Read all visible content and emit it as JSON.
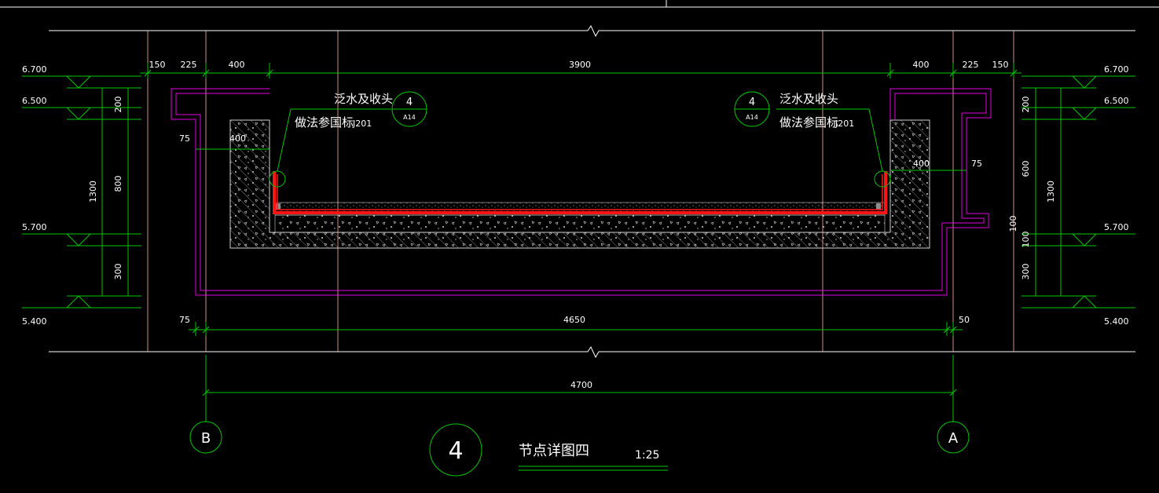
{
  "colors": {
    "background": "#000000",
    "dimension_line": "#00c800",
    "grid_line": "#ffb4a0",
    "outline": "#e600e6",
    "membrane": "#ff1414",
    "text": "#ffffff",
    "hatch": "#b4b4b4"
  },
  "elevations": {
    "left": [
      "6.700",
      "6.500",
      "5.700",
      "5.400"
    ],
    "right": [
      "6.700",
      "6.500",
      "5.700",
      "5.400"
    ]
  },
  "dims": {
    "top_row": [
      "150",
      "225",
      "400",
      "3900",
      "400",
      "225",
      "150"
    ],
    "left_vertical": [
      "200",
      "800",
      "300",
      "1300"
    ],
    "right_vertical": [
      "200",
      "600",
      "100",
      "300",
      "1300",
      "100"
    ],
    "left_inner": [
      "75",
      "400"
    ],
    "right_inner": [
      "400",
      "75"
    ],
    "bottom_row": [
      "75",
      "4650",
      "50"
    ],
    "overall": "4700"
  },
  "callouts": {
    "left": {
      "line1": "泛水及收头",
      "line2": "做法参国标",
      "code": "J201",
      "number": "4",
      "sheet": "A14"
    },
    "right": {
      "line1": "泛水及收头",
      "line2": "做法参国标",
      "code": "J201",
      "number": "4",
      "sheet": "A14"
    }
  },
  "axes": {
    "left": "B",
    "right": "A"
  },
  "title_block": {
    "number": "4",
    "title": "节点详图四",
    "scale": "1:25"
  }
}
